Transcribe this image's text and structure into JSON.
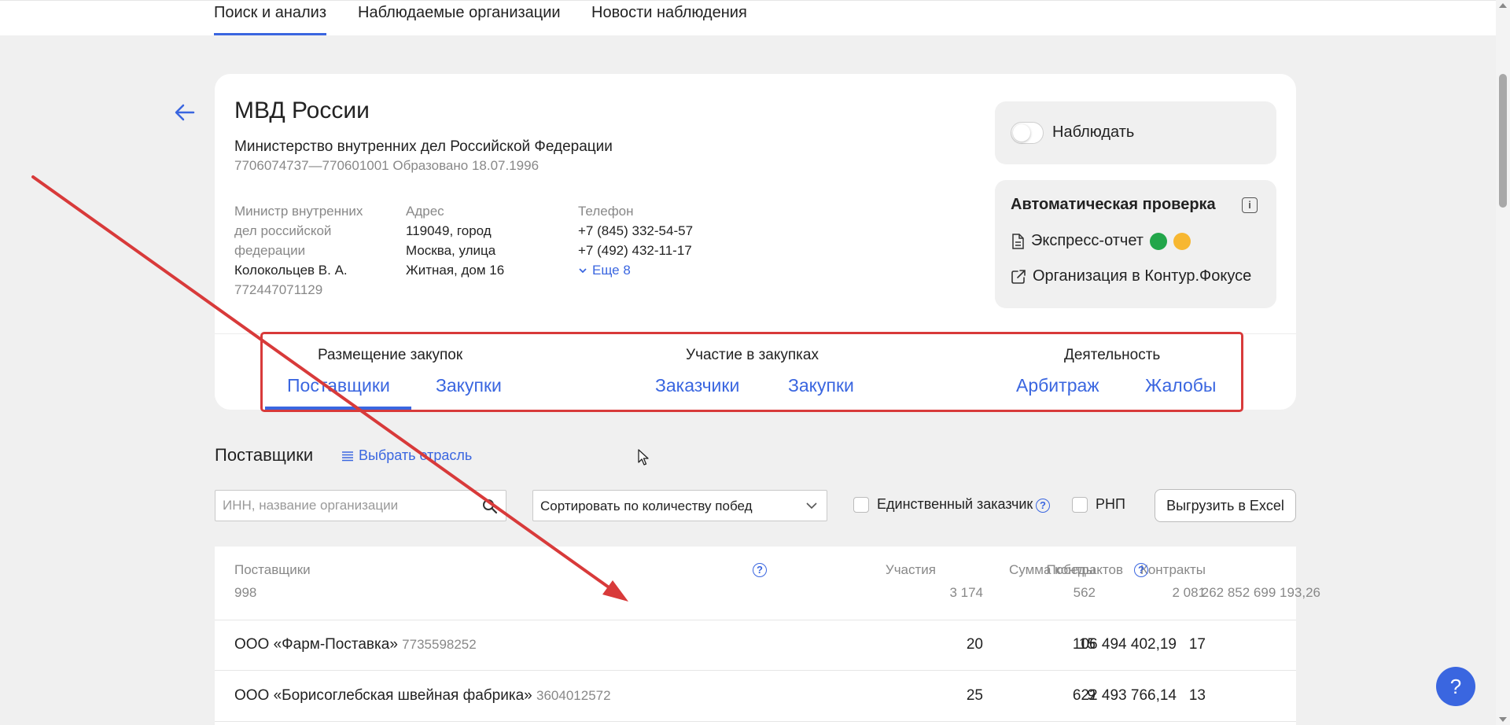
{
  "topnav": {
    "tabs": [
      {
        "label": "Поиск и анализ",
        "active": true
      },
      {
        "label": "Наблюдаемые организации"
      },
      {
        "label": "Новости наблюдения"
      }
    ]
  },
  "org": {
    "short_name": "МВД России",
    "full_name": "Министерство внутренних дел Российской Федерации",
    "meta": "7706074737—770601001 Образовано 18.07.1996",
    "head": {
      "label": "Министр внутренних дел российской федерации",
      "name": "Колокольцев В. А.",
      "inn": "772447071129"
    },
    "address": {
      "label": "Адрес",
      "value": "119049, город Москва, улица Житная, дом 16"
    },
    "phone": {
      "label": "Телефон",
      "values": [
        "+7 (845) 332-54-57",
        "+7 (492) 432-11-17"
      ],
      "more": "Еще 8"
    }
  },
  "watch": {
    "label": "Наблюдать"
  },
  "auto_check": {
    "title": "Автоматическая проверка",
    "express_label": "Экспресс-отчет",
    "kontur_label": "Организация в Контур.Фокусе",
    "colors": {
      "green": "#22a64a",
      "yellow": "#f7b731"
    }
  },
  "sections": {
    "groups": [
      "Размещение закупок",
      "Участие в закупках",
      "Деятельность"
    ],
    "tabs": [
      "Поставщики",
      "Закупки",
      "Заказчики",
      "Закупки",
      "Арбитраж",
      "Жалобы"
    ]
  },
  "suppliers": {
    "title": "Поставщики",
    "choose_industry": "Выбрать отрасль",
    "search_placeholder": "ИНН, название организации",
    "sort_value": "Сортировать по количеству побед",
    "only_customer": "Единственный заказчик",
    "rnp": "РНП",
    "export": "Выгрузить в Excel"
  },
  "table": {
    "headers": [
      "Поставщики",
      "Участия",
      "Победы",
      "Контракты",
      "Сумма контрактов"
    ],
    "totals": [
      "998",
      "3 174",
      "562",
      "2 081",
      "262 852 699 193,26"
    ],
    "rows": [
      {
        "name": "ООО «Фарм-Поставка»",
        "inn": "7735598252",
        "part": "20",
        "wins": "15",
        "contracts": "17",
        "sum": "106 494 402,19"
      },
      {
        "name": "ООО «Борисоглебская швейная фабрика»",
        "inn": "3604012572",
        "part": "25",
        "wins": "9",
        "contracts": "13",
        "sum": "622 493 766,14"
      }
    ]
  },
  "help": {
    "label": "?"
  },
  "accent_color": "#3a66e0",
  "annotation_color": "#d83a3a"
}
